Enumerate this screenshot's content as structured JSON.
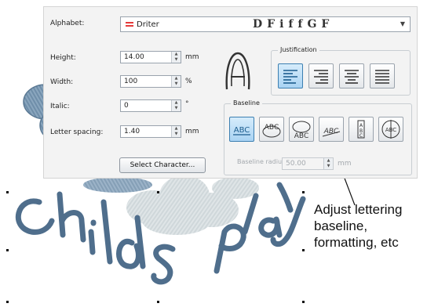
{
  "dialog": {
    "alphabet_label": "Alphabet:",
    "font_name": "Driter",
    "font_preview": "DFiffGF",
    "font_dropdown_arrow": "▼",
    "height_label": "Height:",
    "height_value": "14.00",
    "height_unit": "mm",
    "width_label": "Width:",
    "width_value": "100",
    "width_unit": "%",
    "italic_label": "Italic:",
    "italic_value": "0",
    "italic_unit": "°",
    "letter_spacing_label": "Letter spacing:",
    "letter_spacing_value": "1.40",
    "letter_spacing_unit": "mm",
    "select_character_label": "Select Character...",
    "spin_up": "▲",
    "spin_down": "▼"
  },
  "justification": {
    "title": "Justification",
    "buttons": [
      "align-left",
      "align-right",
      "align-center",
      "align-justify"
    ],
    "active": "align-left"
  },
  "baseline": {
    "title": "Baseline",
    "buttons": [
      "baseline-straight",
      "baseline-arc-top",
      "baseline-arc-bottom",
      "baseline-circle",
      "baseline-vertical",
      "baseline-rotated"
    ],
    "active": "baseline-straight",
    "radius_label": "Baseline radius:",
    "radius_value": "50.00",
    "radius_unit": "mm"
  },
  "artwork": {
    "text": "Childs Play",
    "thread_color": "#4f6e8c",
    "cloud_color": "#d9dfe1"
  },
  "callout": {
    "lines": [
      "Adjust lettering",
      "baseline,",
      "formatting, etc"
    ]
  },
  "colors": {
    "active_button": "#a9d3f3",
    "alphabet_icon": "#e53b3b"
  }
}
